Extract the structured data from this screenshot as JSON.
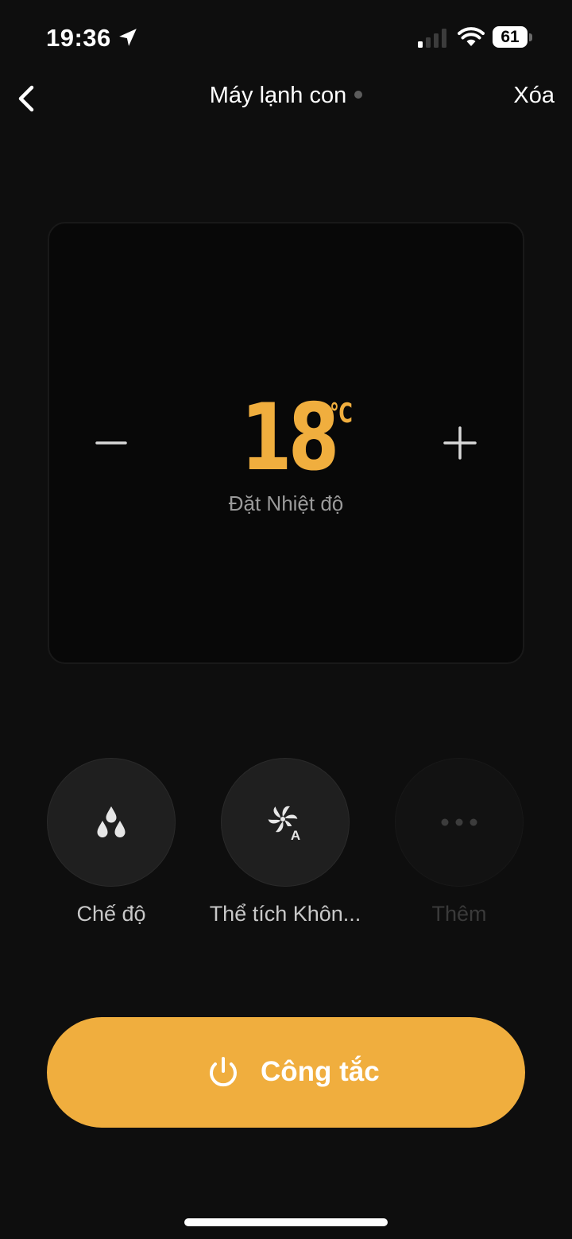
{
  "status_bar": {
    "time": "19:36",
    "battery": "61"
  },
  "nav": {
    "title": "Máy lạnh con",
    "delete_label": "Xóa"
  },
  "temperature": {
    "value": "18",
    "unit": "℃",
    "label": "Đặt Nhiệt độ"
  },
  "controls": [
    {
      "label": "Chế độ",
      "icon": "water-drops-icon",
      "enabled": true
    },
    {
      "label": "Thể tích Khôn...",
      "icon": "fan-auto-icon",
      "enabled": true
    },
    {
      "label": "Thêm",
      "icon": "more-dots-icon",
      "enabled": false
    }
  ],
  "power": {
    "label": "Công tắc",
    "icon": "power-icon"
  },
  "colors": {
    "accent": "#f0ae3e",
    "background": "#0e0e0e",
    "card": "#080808",
    "control": "#1f1f1f"
  }
}
